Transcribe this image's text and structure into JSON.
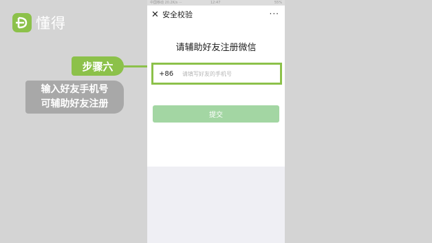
{
  "brand": {
    "name": "懂得",
    "icon": "leaf-d-icon",
    "color": "#8cc14a"
  },
  "annotation": {
    "step_label": "步骤六",
    "desc_line1": "输入好友手机号",
    "desc_line2": "可辅助好友注册"
  },
  "status_bar": {
    "left": "中国移动 20.2K/s ···",
    "center": "12:47",
    "right": "55%"
  },
  "nav": {
    "close_icon": "close-icon",
    "title": "安全校验",
    "more": "···"
  },
  "page": {
    "title": "请辅助好友注册微信",
    "country_code": "+86",
    "phone_placeholder": "请填写好友的手机号",
    "phone_value": "",
    "submit_label": "提交"
  }
}
